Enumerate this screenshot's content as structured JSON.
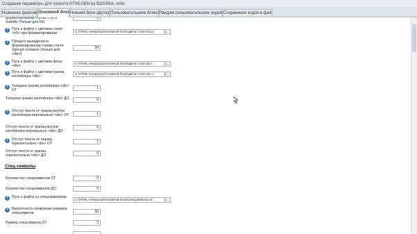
{
  "window": {
    "title": "Создание параметры для проекта HTMLGEN by BOSSKA, xmlo"
  },
  "tabs": [
    "Название файлов",
    "Основной блок",
    "Нижний блок (футер)",
    "Пользовательские блоки",
    "Рандом пользовательских кодов",
    "Сохранение кодов в файл"
  ],
  "rows": {
    "r0": {
      "label": "форматировании строки стиля: Subtitle (Только для h3)",
      "value": "0"
    },
    "r1": {
      "label": "Путь к файлу с цветами стиля <h3> при форматировании",
      "value": "C:\\HTML генератор\\Основной блок\\Цвета стиля h3.tx"
    },
    "r2": {
      "label": "Процент выпадения в форматировании строки стиля: Special container (только для <div>)",
      "value": "50"
    },
    "r3": {
      "label": "Путь к файлу с цветами фона <div>",
      "value": "C:\\HTML генератор\\Основной блок\\Цвета стиля div.t"
    },
    "r4": {
      "label": "Путь к файлу с цветами границ контейнера <div>",
      "value": "C:\\HTML генератор\\Основной блок\\Цвета стиля div о"
    },
    "r5": {
      "label": "Толщина границ контейнера <div> ОТ",
      "value": "1"
    },
    "r6": {
      "label": "Толщина границ контейнера <div> ДО",
      "value": "6"
    },
    "r7": {
      "label": "Отступ текста от границ внутри контейнера вертикально <div> ОТ",
      "value": "1"
    },
    "r8": {
      "label": "Отступ текста от границ внутри контейнера вертикально <div> ДО",
      "value": "6"
    },
    "r9": {
      "label": "Отступ текста от границ горизонтально <div> ОТ",
      "value": "1"
    },
    "r10": {
      "label": "Отступ текста от границ горизонтально <div> ДО",
      "value": "6"
    }
  },
  "section": {
    "title": "Спец символы"
  },
  "spec": {
    "s0": {
      "label": "Количество спецсимволов ОТ",
      "value": "0"
    },
    "s1": {
      "label": "Количество спецсимволов ДО",
      "value": "5"
    },
    "s2": {
      "label": "Путь к файлу со спецсимволами",
      "value": "C:\\HTML генератор\\Основной блок\\Спецсимволы.txt"
    },
    "s3": {
      "label": "Вероятность появления размера спецсимвола",
      "value": "50"
    },
    "s4": {
      "label": "Размер спецсимвола ОТ",
      "value": "2"
    }
  },
  "browse_label": "...",
  "help_glyph": "?",
  "icons": {
    "help": "help-icon",
    "browse": "ellipsis-icon",
    "cursor": "mouse-pointer-icon"
  }
}
